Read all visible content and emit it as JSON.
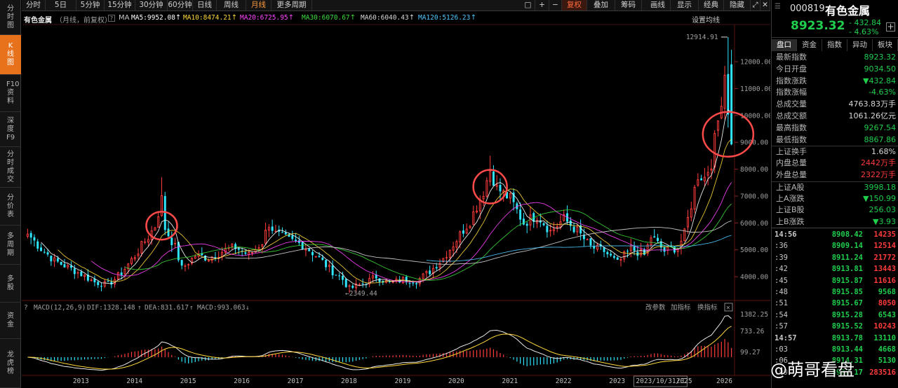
{
  "left_tabs": [
    {
      "label": "分时图",
      "name": "tab-intraday"
    },
    {
      "label": "K线图",
      "name": "tab-kline",
      "active": true
    },
    {
      "label": "F10资料",
      "name": "tab-f10"
    },
    {
      "label": "深度F9",
      "name": "tab-depth-f9"
    },
    {
      "label": "分时成交",
      "name": "tab-time-sales"
    },
    {
      "label": "分价表",
      "name": "tab-price-table"
    },
    {
      "label": "多周期",
      "name": "tab-multi-period"
    },
    {
      "label": "多股",
      "name": "tab-multi-stock"
    },
    {
      "label": "资金",
      "name": "tab-capital"
    },
    {
      "label": "龙虎榜",
      "name": "tab-dragon-tiger"
    }
  ],
  "toolbar": {
    "periods": [
      "分时",
      "5日",
      "5分钟",
      "15分钟",
      "30分钟",
      "60分钟",
      "日线",
      "周线",
      "月线",
      "更多周期"
    ],
    "active_period": "月线",
    "fq": "复权",
    "overlay": "叠加",
    "chips": "筹码",
    "draw": "画线",
    "display": "显示",
    "classic": "经典",
    "hide": "隐藏"
  },
  "main_info": {
    "name": "有色金属",
    "mode": "（月线，前复权）",
    "ma_label": "MA",
    "ma": [
      {
        "label": "MA5:9952.08",
        "color": "#ffffff"
      },
      {
        "label": "MA10:8474.21",
        "color": "#ffd83a"
      },
      {
        "label": "MA20:6725.95",
        "color": "#ff44ff"
      },
      {
        "label": "MA30:6070.67",
        "color": "#3cdc3c"
      },
      {
        "label": "MA60:6040.43",
        "color": "#d8d8d8"
      },
      {
        "label": "MA120:5126.23",
        "color": "#4ec8ff"
      }
    ],
    "settings": "设置均线"
  },
  "price_axis": [
    "12000.00",
    "11000.00",
    "10000.00",
    "9000.00",
    "8000.00",
    "7000.00",
    "6000.00",
    "5000.00",
    "4000.00"
  ],
  "annotations": {
    "high": "12914.91",
    "low": "2349.44"
  },
  "x_axis": [
    "2013",
    "2014",
    "2015",
    "2016",
    "2017",
    "2018",
    "2019",
    "2020",
    "2021",
    "2022",
    "2023",
    "2023/10/31/二",
    "2025",
    "2026"
  ],
  "macd": {
    "title": "MACD(12,26,9)",
    "dif": "DIF:1328.148",
    "dea": "DEA:831.617",
    "macd": "MACD:993.063",
    "buttons": [
      "改参数",
      "加指标",
      "换指标"
    ],
    "axis": [
      "1382.25",
      "733.26",
      "99.27"
    ]
  },
  "chart_data": {
    "type": "candlestick",
    "title": "有色金属",
    "period": "月线",
    "ylim": [
      3900,
      12400
    ],
    "x_ticks": [
      "2013",
      "2014",
      "2015",
      "2016",
      "2017",
      "2018",
      "2019",
      "2020",
      "2021",
      "2022",
      "2023",
      "2025",
      "2026"
    ],
    "anchor_closes": [
      [
        0,
        5600
      ],
      [
        4,
        5050
      ],
      [
        8,
        4600
      ],
      [
        12,
        4350
      ],
      [
        16,
        4100
      ],
      [
        20,
        3800
      ],
      [
        24,
        3700
      ],
      [
        28,
        4150
      ],
      [
        32,
        4800
      ],
      [
        36,
        5500
      ],
      [
        38,
        5900
      ],
      [
        40,
        6900
      ],
      [
        41,
        5800
      ],
      [
        44,
        5100
      ],
      [
        46,
        4300
      ],
      [
        50,
        4800
      ],
      [
        54,
        4700
      ],
      [
        58,
        4950
      ],
      [
        62,
        5100
      ],
      [
        66,
        4800
      ],
      [
        70,
        5300
      ],
      [
        72,
        6000
      ],
      [
        74,
        5600
      ],
      [
        78,
        5350
      ],
      [
        82,
        5200
      ],
      [
        86,
        4800
      ],
      [
        90,
        4300
      ],
      [
        94,
        3900
      ],
      [
        96,
        3550
      ],
      [
        100,
        3750
      ],
      [
        104,
        4000
      ],
      [
        108,
        3750
      ],
      [
        112,
        3900
      ],
      [
        116,
        3850
      ],
      [
        120,
        4200
      ],
      [
        124,
        4700
      ],
      [
        128,
        5400
      ],
      [
        132,
        6100
      ],
      [
        136,
        7200
      ],
      [
        138,
        8000
      ],
      [
        140,
        7300
      ],
      [
        144,
        6900
      ],
      [
        148,
        6000
      ],
      [
        152,
        6300
      ],
      [
        156,
        5700
      ],
      [
        160,
        6150
      ],
      [
        164,
        5700
      ],
      [
        168,
        5100
      ],
      [
        172,
        4950
      ],
      [
        176,
        4500
      ],
      [
        180,
        5050
      ],
      [
        184,
        4800
      ],
      [
        186,
        5500
      ],
      [
        190,
        4950
      ],
      [
        194,
        5100
      ],
      [
        196,
        5600
      ],
      [
        198,
        6700
      ],
      [
        200,
        7800
      ],
      [
        202,
        7700
      ],
      [
        204,
        8300
      ],
      [
        206,
        9800
      ],
      [
        208,
        11600
      ],
      [
        210,
        8923.32
      ]
    ],
    "high": 12914.91,
    "low": 2349.44,
    "ma_values": {
      "MA5": 9952.08,
      "MA10": 8474.21,
      "MA20": 6725.95,
      "MA30": 6070.67,
      "MA60": 6040.43,
      "MA120": 5126.23
    },
    "macd_values": {
      "DIF": 1328.148,
      "DEA": 831.617,
      "MACD": 993.063
    },
    "macd_axis": [
      1382.25,
      733.26,
      99.27
    ],
    "highlight_circles": [
      "2015",
      "2021",
      "2026"
    ]
  },
  "colors": {
    "up": "#ff3b3b",
    "down": "#2ee6ff",
    "accent": "#ff6a3c",
    "green": "#1fce4d"
  },
  "quote": {
    "code": "000819",
    "name": "有色金属",
    "price": "8923.32",
    "change": "- 432.84",
    "pct": "- 4.63%"
  },
  "right_tabs": [
    "盘口",
    "资金",
    "指数",
    "异动",
    "板块"
  ],
  "stats": [
    {
      "k": "最新指数",
      "v": "8923.32",
      "c": "g"
    },
    {
      "k": "今日开盘",
      "v": "9034.50",
      "c": "g"
    },
    {
      "k": "指数涨跌",
      "v": "▼432.84",
      "c": "g"
    },
    {
      "k": "指数涨幅",
      "v": "-4.63%",
      "c": "g"
    },
    {
      "k": "总成交量",
      "v": "4763.83万手",
      "c": "w"
    },
    {
      "k": "总成交额",
      "v": "1061.26亿元",
      "c": "w"
    },
    {
      "k": "最高指数",
      "v": "9267.54",
      "c": "g"
    },
    {
      "k": "最低指数",
      "v": "8867.86",
      "c": "g"
    },
    {
      "k": "上证换手",
      "v": "1.68%",
      "c": "w"
    },
    {
      "k": "内盘总量",
      "v": "2442万手",
      "c": "r"
    },
    {
      "k": "外盘总量",
      "v": "2322万手",
      "c": "r"
    },
    {
      "k": "上证A股",
      "v": "3998.18",
      "c": "g"
    },
    {
      "k": "上A涨跌",
      "v": "▼150.99",
      "c": "g"
    },
    {
      "k": "上证B股",
      "v": "256.03",
      "c": "g"
    },
    {
      "k": "上B涨跌",
      "v": "▼3.93",
      "c": "g"
    }
  ],
  "ticks": [
    {
      "t": "14:56",
      "p": "8908.42",
      "q": "14235",
      "qc": "r"
    },
    {
      "t": ":36",
      "p": "8909.14",
      "q": "12514",
      "qc": "r"
    },
    {
      "t": ":39",
      "p": "8911.24",
      "q": "21772",
      "qc": "r"
    },
    {
      "t": ":42",
      "p": "8913.81",
      "q": "13443",
      "qc": "r"
    },
    {
      "t": ":45",
      "p": "8915.87",
      "q": "11616",
      "qc": "r"
    },
    {
      "t": ":48",
      "p": "8915.85",
      "q": "9568",
      "qc": "g"
    },
    {
      "t": ":51",
      "p": "8915.67",
      "q": "8050",
      "qc": "r"
    },
    {
      "t": ":54",
      "p": "8915.28",
      "q": "6543",
      "qc": "g"
    },
    {
      "t": ":57",
      "p": "8915.52",
      "q": "10243",
      "qc": "r"
    },
    {
      "t": "14:57",
      "p": "8913.78",
      "q": "13110",
      "qc": "g"
    },
    {
      "t": ":03",
      "p": "8913.44",
      "q": "4668",
      "qc": "g"
    },
    {
      "t": ":06",
      "p": "8914.31",
      "q": "5130",
      "qc": "g"
    },
    {
      "t": ":09",
      "p": "8922.17",
      "q": "283516",
      "qc": "r"
    }
  ],
  "watermark": "@萌哥看盘"
}
